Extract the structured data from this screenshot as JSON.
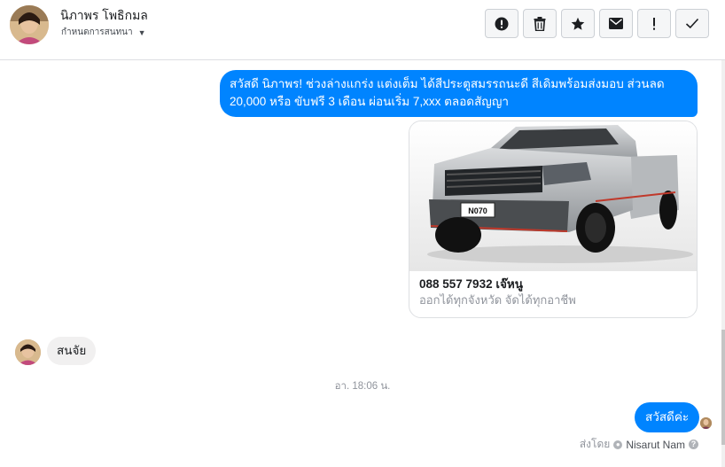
{
  "header": {
    "contact_name": "นิภาพร โพธิกมล",
    "action_label": "กำหนดการสนทนา",
    "tools": [
      {
        "name": "report",
        "icon": "alert-circle-icon"
      },
      {
        "name": "delete",
        "icon": "trash-icon"
      },
      {
        "name": "star",
        "icon": "star-icon"
      },
      {
        "name": "mark-unread",
        "icon": "envelope-icon"
      },
      {
        "name": "spam",
        "icon": "exclamation-icon"
      },
      {
        "name": "done",
        "icon": "checkmark-icon"
      }
    ]
  },
  "messages": {
    "outgoing_1": "สวัสดี นิภาพร! ช่วงล่างแกร่ง แต่งเต็ม ได้สีประตูสมรรถนะดี สีเดิมพร้อมส่งมอบ ส่วนลด 20,000 หรือ ขับฟรี 3 เดือน ผ่อนเริ่ม 7,xxx ตลอดสัญญา",
    "card": {
      "title": "088 557 7932 เจ๊หนู",
      "subtitle": "ออกได้ทุกจังหวัด จัดได้ทุกอาชีพ",
      "plate": "N070"
    },
    "incoming_1": "สนจัย",
    "timestamp": "อา. 18:06 น.",
    "outgoing_2": "สวัสดีค่ะ",
    "sent_by_label": "ส่งโดย",
    "sent_by_name": "Nisarut Nam"
  },
  "colors": {
    "accent": "#0084ff",
    "incoming_bubble": "#f1f0f0",
    "muted_text": "#90949c"
  }
}
